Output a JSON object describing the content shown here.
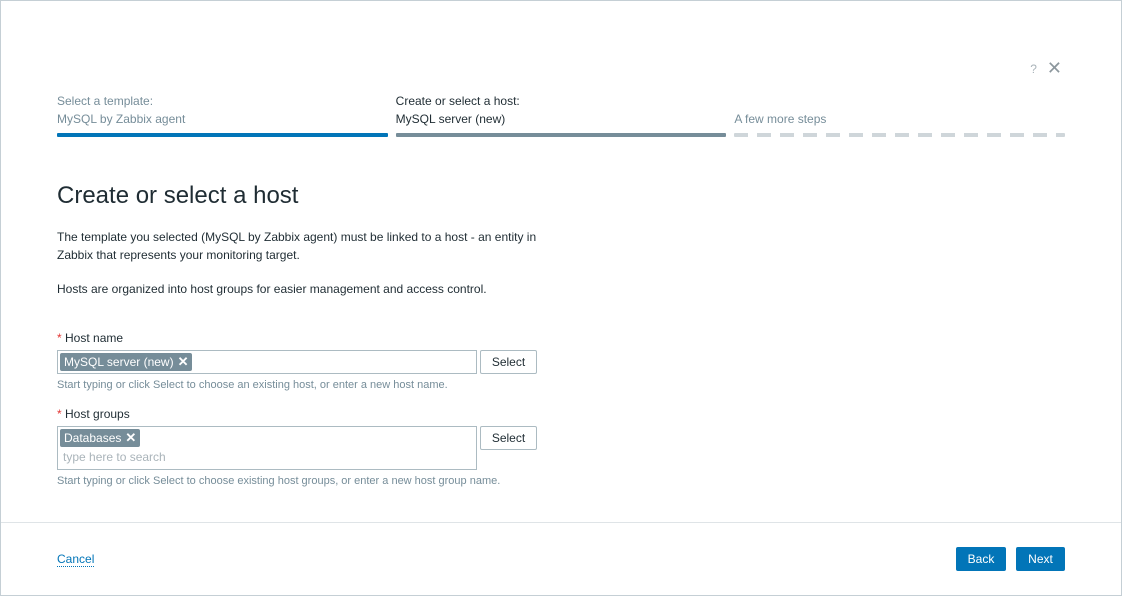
{
  "header": {
    "help_icon": "?",
    "close_icon": "✕"
  },
  "steps": [
    {
      "title": "Select a template:",
      "value": "MySQL by Zabbix agent"
    },
    {
      "title": "Create or select a host:",
      "value": "MySQL server (new)"
    },
    {
      "title": "A few more steps"
    }
  ],
  "page": {
    "title": "Create or select a host",
    "intro": "The template you selected (MySQL by Zabbix agent) must be linked to a host - an entity in Zabbix that represents your monitoring target.",
    "intro2": "Hosts are organized into host groups for easier management and access control."
  },
  "host_name": {
    "required": "*",
    "label": "Host name",
    "chip": "MySQL server (new)",
    "select": "Select",
    "hint": "Start typing or click Select to choose an existing host, or enter a new host name."
  },
  "host_groups": {
    "required": "*",
    "label": "Host groups",
    "chip": "Databases",
    "placeholder": "type here to search",
    "select": "Select",
    "hint": "Start typing or click Select to choose existing host groups, or enter a new host group name."
  },
  "footer": {
    "cancel": "Cancel",
    "back": "Back",
    "next": "Next"
  },
  "chip_remove": "✕"
}
